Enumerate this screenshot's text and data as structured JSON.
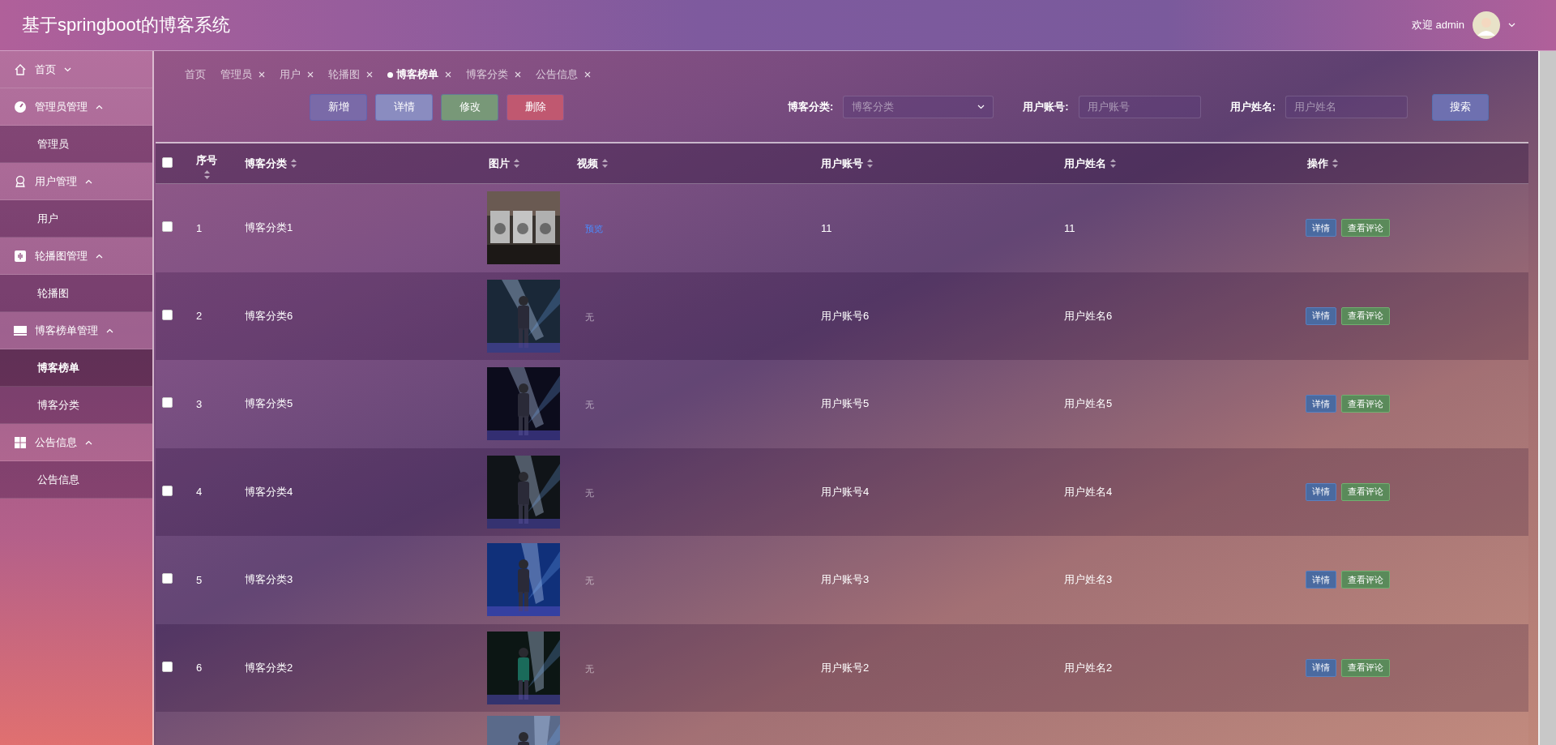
{
  "header": {
    "title": "基于springboot的博客系统",
    "welcome": "欢迎 admin"
  },
  "sidebar": {
    "items": [
      {
        "label": "首页",
        "expanded": false
      },
      {
        "label": "管理员管理",
        "expanded": true,
        "children": [
          {
            "label": "管理员",
            "selected": false
          }
        ]
      },
      {
        "label": "用户管理",
        "expanded": true,
        "children": [
          {
            "label": "用户",
            "selected": false
          }
        ]
      },
      {
        "label": "轮播图管理",
        "expanded": true,
        "children": [
          {
            "label": "轮播图",
            "selected": false
          }
        ]
      },
      {
        "label": "博客榜单管理",
        "expanded": true,
        "children": [
          {
            "label": "博客榜单",
            "selected": true
          },
          {
            "label": "博客分类",
            "selected": false
          }
        ]
      },
      {
        "label": "公告信息",
        "expanded": true,
        "children": [
          {
            "label": "公告信息",
            "selected": false
          }
        ]
      }
    ]
  },
  "tabs": [
    {
      "label": "首页",
      "selected": false,
      "closable": false
    },
    {
      "label": "管理员",
      "selected": false,
      "closable": true
    },
    {
      "label": "用户",
      "selected": false,
      "closable": true
    },
    {
      "label": "轮播图",
      "selected": false,
      "closable": true
    },
    {
      "label": "博客榜单",
      "selected": true,
      "closable": true
    },
    {
      "label": "博客分类",
      "selected": false,
      "closable": true
    },
    {
      "label": "公告信息",
      "selected": false,
      "closable": true
    }
  ],
  "toolbar": {
    "buttons": [
      {
        "label": "新增",
        "kind": "add"
      },
      {
        "label": "详情",
        "kind": "detail"
      },
      {
        "label": "修改",
        "kind": "edit"
      },
      {
        "label": "删除",
        "kind": "delete"
      }
    ],
    "filters": [
      {
        "label": "博客分类:",
        "placeholder": "博客分类",
        "kind": "select"
      },
      {
        "label": "用户账号:",
        "placeholder": "用户账号",
        "kind": "input"
      },
      {
        "label": "用户姓名:",
        "placeholder": "用户姓名",
        "kind": "input"
      }
    ],
    "search": "搜索"
  },
  "table": {
    "select_all_checked": false,
    "columns": [
      {
        "label": "序号"
      },
      {
        "label": "博客分类"
      },
      {
        "label": "图片"
      },
      {
        "label": "视频"
      },
      {
        "label": "用户账号"
      },
      {
        "label": "用户姓名"
      },
      {
        "label": "操作"
      }
    ],
    "rows": [
      {
        "kind": "full",
        "checked": false,
        "index": "1",
        "category": "博客分类1",
        "video": {
          "kind": "link",
          "text": "预览"
        },
        "account": "11",
        "name": "11",
        "actions": [
          "详情",
          "查看评论"
        ]
      },
      {
        "kind": "full",
        "checked": false,
        "index": "2",
        "category": "博客分类6",
        "video": {
          "kind": "none",
          "text": "无"
        },
        "account": "用户账号6",
        "name": "用户姓名6",
        "actions": [
          "详情",
          "查看评论"
        ]
      },
      {
        "kind": "full",
        "checked": false,
        "index": "3",
        "category": "博客分类5",
        "video": {
          "kind": "none",
          "text": "无"
        },
        "account": "用户账号5",
        "name": "用户姓名5",
        "actions": [
          "详情",
          "查看评论"
        ]
      },
      {
        "kind": "full",
        "checked": false,
        "index": "4",
        "category": "博客分类4",
        "video": {
          "kind": "none",
          "text": "无"
        },
        "account": "用户账号4",
        "name": "用户姓名4",
        "actions": [
          "详情",
          "查看评论"
        ]
      },
      {
        "kind": "full",
        "checked": false,
        "index": "5",
        "category": "博客分类3",
        "video": {
          "kind": "none",
          "text": "无"
        },
        "account": "用户账号3",
        "name": "用户姓名3",
        "actions": [
          "详情",
          "查看评论"
        ]
      },
      {
        "kind": "full",
        "checked": false,
        "index": "6",
        "category": "博客分类2",
        "video": {
          "kind": "none",
          "text": "无"
        },
        "account": "用户账号2",
        "name": "用户姓名2",
        "actions": [
          "详情",
          "查看评论"
        ]
      },
      {
        "kind": "cut"
      }
    ]
  }
}
